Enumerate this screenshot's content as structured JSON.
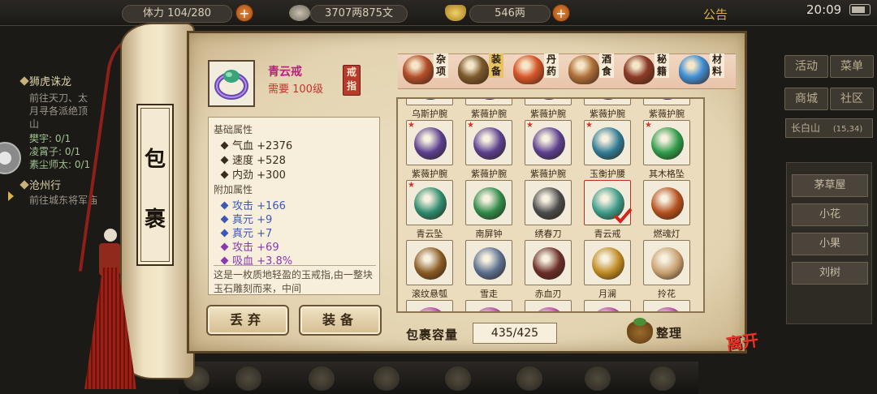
{
  "hud": {
    "stamina_label": "体力",
    "stamina_value": "104/280",
    "copper": "3707两875文",
    "silver": "546两",
    "notice": "公告",
    "clock": "20:09"
  },
  "quests": [
    {
      "title": "狮虎诛龙",
      "lines": [
        "前往天刀、太",
        "月寻各派绝顶",
        "山"
      ],
      "subs": [
        "樊宇: 0/1",
        "凌霄子: 0/1",
        "素尘师太: 0/1"
      ]
    },
    {
      "title": "沧州行",
      "lines": [
        "前往城东将军庙"
      ]
    }
  ],
  "right_menu": {
    "row1": [
      "活动",
      "菜单"
    ],
    "row2": [
      "商城",
      "社区"
    ],
    "location": "长白山",
    "coords": "(15,34)",
    "npcs": [
      "茅草屋",
      "小花",
      "小果",
      "刘树"
    ]
  },
  "scroll": {
    "chars": [
      "包",
      "裹"
    ]
  },
  "item": {
    "name": "青云戒",
    "requirement": "需要 100级",
    "type": "戒指",
    "base_header": "基础属性",
    "base_stats": [
      {
        "name": "气血",
        "value": "+2376"
      },
      {
        "name": "速度",
        "value": "+528"
      },
      {
        "name": "内劲",
        "value": "+300"
      }
    ],
    "extra_header": "附加属性",
    "extra_stats": [
      {
        "name": "攻击",
        "value": "+166",
        "color": "#3c57b8"
      },
      {
        "name": "真元",
        "value": "+9",
        "color": "#3c57b8"
      },
      {
        "name": "真元",
        "value": "+7",
        "color": "#3c57b8"
      },
      {
        "name": "攻击",
        "value": "+69",
        "color": "#8a3ab0"
      },
      {
        "name": "吸血",
        "value": "+3.8%",
        "color": "#8a3ab0"
      }
    ],
    "description": "这是一枚质地轻盈的玉戒指,由一整块玉石雕刻而来，中间"
  },
  "buttons": {
    "discard": "丢弃",
    "equip": "装备",
    "sort": "整理",
    "leave": "离开"
  },
  "categories": [
    {
      "label": "杂项",
      "icon": "jar-icon",
      "color": "#b34e2a"
    },
    {
      "label": "装备",
      "icon": "equipment-icon",
      "color": "#7c5a2c"
    },
    {
      "label": "丹药",
      "icon": "pill-icon",
      "color": "#d8562a"
    },
    {
      "label": "酒食",
      "icon": "food-icon",
      "color": "#b0703a"
    },
    {
      "label": "秘籍",
      "icon": "book-icon",
      "color": "#8c3a28"
    },
    {
      "label": "材料",
      "icon": "crystal-icon",
      "color": "#3f8fd6"
    }
  ],
  "active_category": 1,
  "grid_items": [
    {
      "label": "乌斯护腕",
      "color": "#3b5a9e",
      "star": false
    },
    {
      "label": "紫薇护腕",
      "color": "#5a3e8e",
      "star": false
    },
    {
      "label": "紫薇护腕",
      "color": "#5a3e8e",
      "star": false
    },
    {
      "label": "紫薇护腕",
      "color": "#5a3e8e",
      "star": false
    },
    {
      "label": "紫薇护腕",
      "color": "#5a3e8e",
      "star": false
    },
    {
      "label": "紫薇护腕",
      "color": "#5a3e8e",
      "star": true
    },
    {
      "label": "紫薇护腕",
      "color": "#5a3e8e",
      "star": true
    },
    {
      "label": "紫薇护腕",
      "color": "#5a3e8e",
      "star": true
    },
    {
      "label": "玉衡护腰",
      "color": "#2f7a94",
      "star": true
    },
    {
      "label": "其木格坠",
      "color": "#2e9a4a",
      "star": true
    },
    {
      "label": "青云坠",
      "color": "#2e8a6e",
      "star": true
    },
    {
      "label": "南屏钟",
      "color": "#2f8a4a",
      "star": false
    },
    {
      "label": "绣春刀",
      "color": "#4a4a4a",
      "star": false
    },
    {
      "label": "青云戒",
      "color": "#3c9a88",
      "star": false,
      "selected": true
    },
    {
      "label": "燃魂灯",
      "color": "#b4501e",
      "star": false
    },
    {
      "label": "滚纹悬瓠",
      "color": "#8a5a24",
      "star": false
    },
    {
      "label": "雪走",
      "color": "#5a6e8e",
      "star": false
    },
    {
      "label": "赤血刃",
      "color": "#6a2e28",
      "star": false
    },
    {
      "label": "月澜",
      "color": "#c08a22",
      "star": false
    },
    {
      "label": "拎花",
      "color": "#c9a070",
      "star": false
    },
    {
      "label": "",
      "color": "#b040a0",
      "star": false
    },
    {
      "label": "",
      "color": "#b040a0",
      "star": false
    },
    {
      "label": "",
      "color": "#b040a0",
      "star": false
    },
    {
      "label": "",
      "color": "#b040a0",
      "star": false
    },
    {
      "label": "",
      "color": "#b040a0",
      "star": false
    }
  ],
  "capacity": {
    "label": "包裹容量",
    "value": "435/425"
  }
}
